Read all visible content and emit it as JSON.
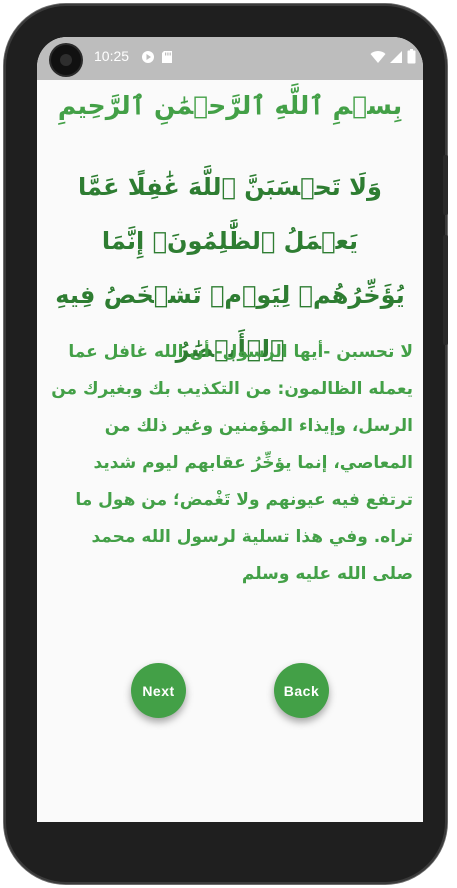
{
  "status_bar": {
    "time": "10:25",
    "icons": [
      "play-protect-icon",
      "sd-card-icon",
      "wifi-icon",
      "signal-icon",
      "battery-icon"
    ]
  },
  "basmala": "بِسۡمِ ٱللَّهِ ٱلرَّحۡمَٰنِ ٱلرَّحِيمِ",
  "ayah": "وَلَا تَحۡسَبَنَّ ٱللَّهَ غَٰفِلًا عَمَّا يَعۡمَلُ ٱلظَّٰلِمُونَۚ إِنَّمَا يُؤَخِّرُهُمۡ لِيَوۡمٖ تَشۡخَصُ فِيهِ ٱلۡأَبۡصَٰرُ",
  "tafsir": "لا تحسبن -أيها الرسول- أن الله غافل عما يعمله الظالمون: من التكذيب بك وبغيرك من الرسل، وإيذاء المؤمنين وغير ذلك من المعاصي، إنما يؤخِّرُ عقابهم ليوم شديد ترتفع فيه عيونهم ولا تَغْمض؛ من هول ما تراه. وفي هذا تسلية لرسول الله محمد صلى الله عليه وسلم",
  "buttons": {
    "next": "Next",
    "back": "Back"
  },
  "colors": {
    "accent": "#43a047",
    "ayah_text": "#2e7d32",
    "status_bar": "#bdbdbd",
    "background": "#fafafa"
  }
}
